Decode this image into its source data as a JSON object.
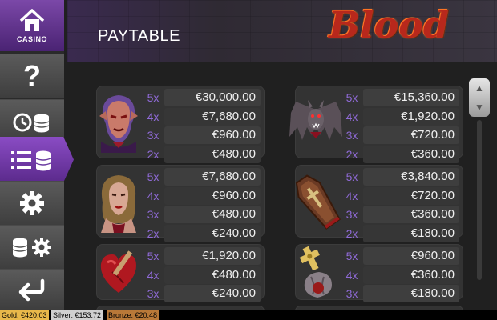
{
  "sidebar": {
    "casino_label": "CASINO",
    "items": [
      {
        "icon": "help-icon",
        "glyph": "?"
      },
      {
        "icon": "history-coins-icon"
      },
      {
        "icon": "paytable-list-icon"
      },
      {
        "icon": "gear-icon"
      },
      {
        "icon": "coins-settings-icon"
      },
      {
        "icon": "back-arrow-icon"
      }
    ]
  },
  "header": {
    "title": "PAYTABLE",
    "logo_text": "Blood"
  },
  "paytable": [
    {
      "symbol": "vampire-man-icon",
      "rows": [
        {
          "mult": "5x",
          "pay": "€30,000.00"
        },
        {
          "mult": "4x",
          "pay": "€7,680.00"
        },
        {
          "mult": "3x",
          "pay": "€960.00"
        },
        {
          "mult": "2x",
          "pay": "€480.00"
        }
      ]
    },
    {
      "symbol": "bat-icon",
      "rows": [
        {
          "mult": "5x",
          "pay": "€15,360.00"
        },
        {
          "mult": "4x",
          "pay": "€1,920.00"
        },
        {
          "mult": "3x",
          "pay": "€720.00"
        },
        {
          "mult": "2x",
          "pay": "€360.00"
        }
      ]
    },
    {
      "symbol": "vampire-woman-icon",
      "rows": [
        {
          "mult": "5x",
          "pay": "€7,680.00"
        },
        {
          "mult": "4x",
          "pay": "€960.00"
        },
        {
          "mult": "3x",
          "pay": "€480.00"
        },
        {
          "mult": "2x",
          "pay": "€240.00"
        }
      ]
    },
    {
      "symbol": "coffin-icon",
      "rows": [
        {
          "mult": "5x",
          "pay": "€3,840.00"
        },
        {
          "mult": "4x",
          "pay": "€720.00"
        },
        {
          "mult": "3x",
          "pay": "€360.00"
        },
        {
          "mult": "2x",
          "pay": "€180.00"
        }
      ]
    },
    {
      "symbol": "heart-stake-icon",
      "rows": [
        {
          "mult": "5x",
          "pay": "€1,920.00"
        },
        {
          "mult": "4x",
          "pay": "€480.00"
        },
        {
          "mult": "3x",
          "pay": "€240.00"
        }
      ]
    },
    {
      "symbol": "cross-garlic-icon",
      "rows": [
        {
          "mult": "5x",
          "pay": "€960.00"
        },
        {
          "mult": "4x",
          "pay": "€360.00"
        },
        {
          "mult": "3x",
          "pay": "€180.00"
        }
      ]
    }
  ],
  "footer": {
    "gold": "Gold: €420.03",
    "silver": "Silver: €153.72",
    "bronze": "Bronze: €20.48"
  }
}
